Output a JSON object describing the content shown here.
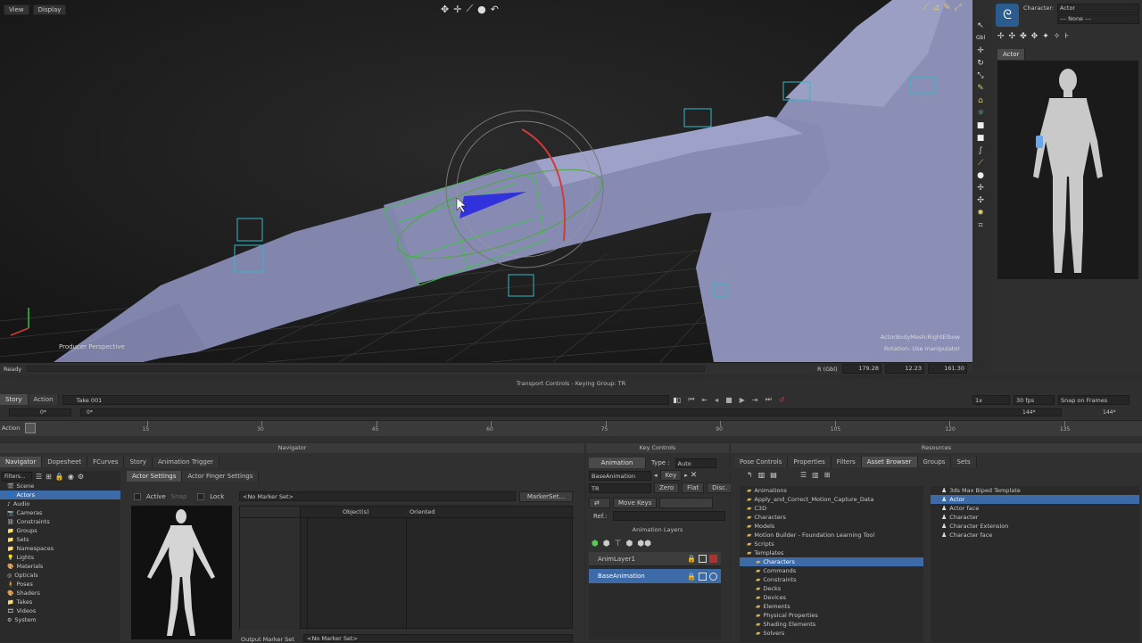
{
  "menu": {
    "view": "View",
    "display": "Display"
  },
  "viewport": {
    "label": "Producer Perspective",
    "info_line1": "ActorBodyMesh:RightElbow",
    "info_line2": "Rotation: Use manipulator",
    "status": "Ready",
    "coords_label": "R (Gbl)",
    "coord_x": "179.28",
    "coord_y": "12.23",
    "coord_z": "161.30"
  },
  "right_panel": {
    "character_label": "Character:",
    "character_value": "Actor",
    "none_value": "--- None ---",
    "tab": "Actor"
  },
  "transport": {
    "title": "Transport Controls  -  Keying Group: TR",
    "story_tab": "Story",
    "action_tab": "Action",
    "take": "Take 001",
    "speed": "1x",
    "fps": "30 fps",
    "snap": "Snap on Frames",
    "start_field": "0*",
    "cur_field": "0*",
    "end1": "144*",
    "end2": "144*",
    "action_label": "Action",
    "ticks": [
      "15",
      "30",
      "45",
      "60",
      "75",
      "90",
      "105",
      "120",
      "135"
    ]
  },
  "navigator": {
    "title": "Navigator",
    "tabs": [
      "Navigator",
      "Dopesheet",
      "FCurves",
      "Story",
      "Animation Trigger"
    ],
    "filters": "Filters...",
    "tree": [
      "Scene",
      "Actors",
      "Audio",
      "Cameras",
      "Constraints",
      "Groups",
      "Sets",
      "Namespaces",
      "Lights",
      "Materials",
      "Opticals",
      "Poses",
      "Shaders",
      "Takes",
      "Videos",
      "System"
    ],
    "subtabs": [
      "Actor Settings",
      "Actor Finger Settings"
    ],
    "active": "Active",
    "snap": "Snap",
    "lock": "Lock",
    "marker_set": "<No Marker Set>",
    "marker_btn": "MarkerSet...",
    "col_objects": "Object(s)",
    "col_oriented": "Oriented",
    "output_marker": "Output Marker Set",
    "output_value": "<No Marker Set>"
  },
  "key_controls": {
    "title": "Key Controls",
    "animation": "Animation",
    "type_label": "Type :",
    "type_value": "Auto",
    "base_anim": "BaseAnimation",
    "key_btn": "Key",
    "tr": "TR",
    "zero": "Zero",
    "flat": "Flat",
    "disc": "Disc.",
    "move_keys": "Move Keys",
    "ref": "Ref.:",
    "layers_title": "Animation Layers",
    "layers": [
      "AnimLayer1",
      "BaseAnimation"
    ]
  },
  "resources": {
    "title": "Resources",
    "tabs": [
      "Pose Controls",
      "Properties",
      "Filters",
      "Asset Browser",
      "Groups",
      "Sets"
    ],
    "tree": [
      "Animations",
      "Apply_and_Correct_Motion_Capture_Data",
      "C3D",
      "Characters",
      "Models",
      "Motion Builder - Foundation Learning Tool",
      "Scripts",
      "Templates",
      "Characters",
      "Commands",
      "Constraints",
      "Decks",
      "Devices",
      "Elements",
      "Physical Properties",
      "Shading Elements",
      "Solvers"
    ],
    "assets": [
      "3ds Max Biped Template",
      "Actor",
      "Actor face",
      "Character",
      "Character Extension",
      "Character face"
    ]
  },
  "colors": {
    "accent": "#3c6ba8",
    "mesh": "#8b8fb6",
    "bg": "#2d2d2d"
  }
}
